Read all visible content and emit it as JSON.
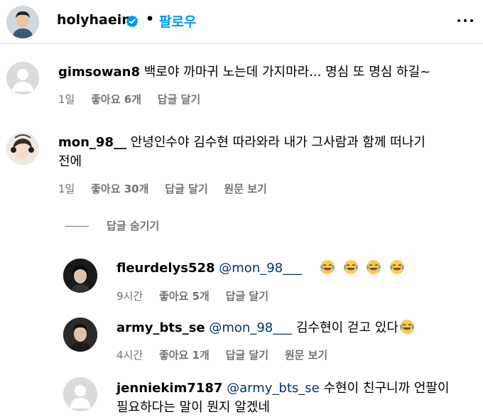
{
  "header": {
    "username": "holyhaein",
    "separator": "•",
    "follow_label": "팔로우"
  },
  "comments": [
    {
      "username": "gimsowan8",
      "text": "백로야 까마귀 노는데 가지마라... 명심 또 명심 하길~",
      "time": "1일",
      "likes": "좋아요 6개",
      "reply_label": "답글 달기"
    },
    {
      "username": "mon_98__",
      "text_line1": "안녕인수야 김수현 따라와라 내가 그사람과 함께 떠나기",
      "text_line2": "전에",
      "time": "1일",
      "likes": "좋아요 30개",
      "reply_label": "답글 달기",
      "translate_label": "원문 보기"
    }
  ],
  "hide_replies_label": "답글 숨기기",
  "replies": [
    {
      "username": "fleurdelys528",
      "mention": "@mon_98___",
      "text": "",
      "emoji_count": 4,
      "time": "9시간",
      "likes": "좋아요 5개",
      "reply_label": "답글 달기"
    },
    {
      "username": "army_bts_se",
      "mention": "@mon_98___",
      "text": "김수현이 걷고 있다",
      "emoji_count": 1,
      "time": "4시간",
      "likes": "좋아요 1개",
      "reply_label": "답글 달기",
      "translate_label": "원문 보기"
    },
    {
      "username": "jenniekim7187",
      "mention": "@army_bts_se",
      "text_line1": "수현이 친구니까 언팔이",
      "text_line2": "필요하다는 말이 뭔지 알겠네"
    }
  ],
  "colors": {
    "link_blue": "#0095f6",
    "mention_blue": "#00376b",
    "meta_gray": "#737373",
    "divider": "#dbdbdb"
  },
  "icons": [
    "verified-badge-icon",
    "more-options-icon",
    "laughing-crying-emoji"
  ]
}
